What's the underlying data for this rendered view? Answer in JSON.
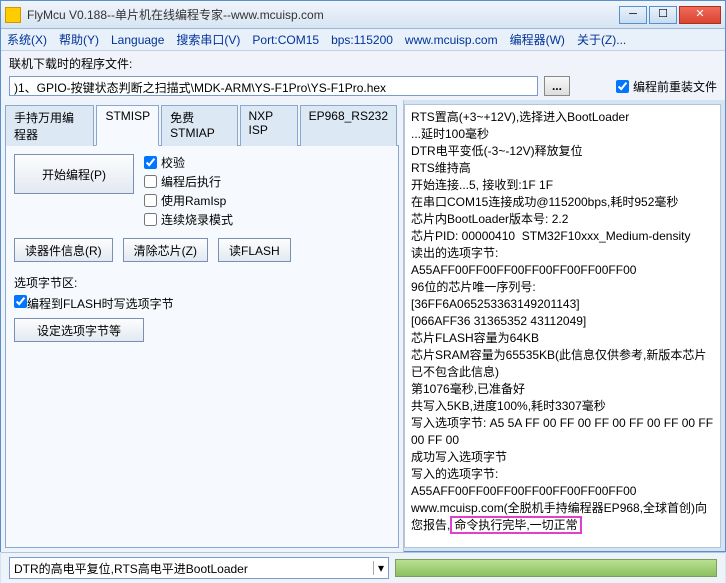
{
  "window": {
    "title": "FlyMcu V0.188--单片机在线编程专家--www.mcuisp.com"
  },
  "menu": {
    "system": "系统(X)",
    "help": "帮助(Y)",
    "language": "Language",
    "search": "搜索串口(V)",
    "port": "Port:COM15",
    "bps": "bps:115200",
    "site": "www.mcuisp.com",
    "programmer": "编程器(W)",
    "about": "关于(Z)..."
  },
  "file_row": {
    "label": "联机下载时的程序文件:",
    "path": ")1、GPIO-按键状态判断之扫描式\\MDK-ARM\\YS-F1Pro\\YS-F1Pro.hex",
    "browse": "...",
    "reinstall": "编程前重装文件"
  },
  "tabs": {
    "t0": "手持万用编程器",
    "t1": "STMISP",
    "t2": "免费STMIAP",
    "t3": "NXP ISP",
    "t4": "EP968_RS232"
  },
  "stmisp": {
    "start": "开始编程(P)",
    "opt_verify": "校验",
    "opt_runafter": "编程后执行",
    "opt_ramisp": "使用RamIsp",
    "opt_cont": "连续烧录模式",
    "btn_readinfo": "读器件信息(R)",
    "btn_erase": "清除芯片(Z)",
    "btn_readflash": "读FLASH",
    "sect_label": "选项字节区:",
    "opt_writeopt": "编程到FLASH时写选项字节",
    "btn_setopt": "设定选项字节等"
  },
  "log": "RTS置高(+3~+12V),选择进入BootLoader\n...延时100毫秒\nDTR电平变低(-3~-12V)释放复位\nRTS维持高\n开始连接...5, 接收到:1F 1F\n在串口COM15连接成功@115200bps,耗时952毫秒\n芯片内BootLoader版本号: 2.2\n芯片PID: 00000410  STM32F10xxx_Medium-density\n读出的选项字节:\nA55AFF00FF00FF00FF00FF00FF00FF00\n96位的芯片唯一序列号:\n[36FF6A065253363149201143]\n[066AFF36 31365352 43112049]\n芯片FLASH容量为64KB\n芯片SRAM容量为65535KB(此信息仅供参考,新版本芯片已不包含此信息)\n第1076毫秒,已准备好\n共写入5KB,进度100%,耗时3307毫秒\n写入选项字节: A5 5A FF 00 FF 00 FF 00 FF 00 FF 00 FF 00 FF 00\n成功写入选项字节\n写入的选项字节:\nA55AFF00FF00FF00FF00FF00FF00FF00\nwww.mcuisp.com(全脱机手持编程器EP968,全球首创)向您报告,",
  "log_hl": "命令执行完毕,一切正常",
  "bottom": {
    "combo": "DTR的高电平复位,RTS高电平进BootLoader"
  }
}
